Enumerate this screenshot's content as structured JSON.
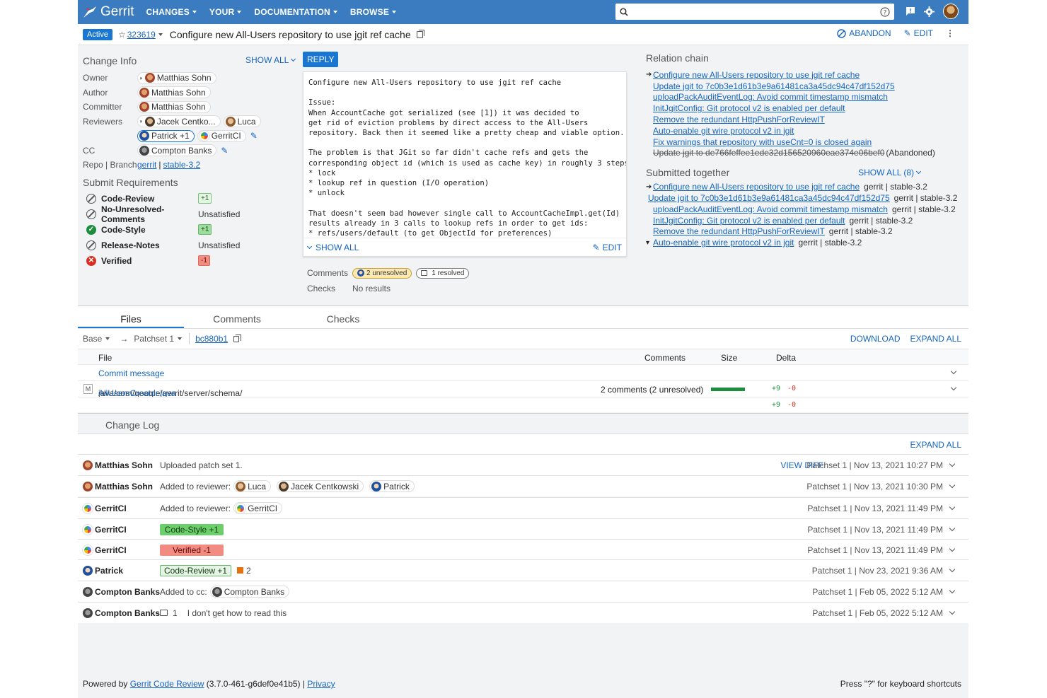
{
  "header": {
    "app_name": "Gerrit",
    "nav": [
      "CHANGES",
      "YOUR",
      "DOCUMENTATION",
      "BROWSE"
    ],
    "search_placeholder": "",
    "colors": {
      "brand": "#3b7bbf",
      "accent": "#1976d2"
    }
  },
  "change": {
    "status": "Active",
    "number": "323619",
    "subject": "Configure new All-Users repository to use jgit ref cache",
    "actions": {
      "abandon": "ABANDON",
      "edit": "EDIT"
    }
  },
  "change_info": {
    "title": "Change Info",
    "show_all": "SHOW ALL",
    "labels": {
      "owner": "Owner",
      "author": "Author",
      "committer": "Committer",
      "reviewers": "Reviewers",
      "cc": "CC",
      "repo_branch": "Repo | Branch"
    },
    "owner": "Matthias Sohn",
    "author": "Matthias Sohn",
    "committer": "Matthias Sohn",
    "reviewers": [
      "Jacek Centko...",
      "Luca",
      "Patrick +1",
      "GerritCI"
    ],
    "cc": [
      "Compton Banks"
    ],
    "repo": "gerrit",
    "branch": "stable-3.2"
  },
  "submit_requirements": {
    "title": "Submit Requirements",
    "items": [
      {
        "name": "Code-Review",
        "status": "neutral",
        "value": "+1"
      },
      {
        "name": "No-Unresolved-Comments",
        "status": "neutral",
        "value": "Unsatisfied"
      },
      {
        "name": "Code-Style",
        "status": "ok",
        "value": "+1"
      },
      {
        "name": "Release-Notes",
        "status": "neutral",
        "value": "Unsatisfied"
      },
      {
        "name": "Verified",
        "status": "bad",
        "value": "-1"
      }
    ]
  },
  "message": {
    "reply": "REPLY",
    "body": "Configure new All-Users repository to use jgit ref cache\n\nIssue:\nWhen AccountCache got serialized (see [1]) it was decided to\nget rid of eviction problems by direct access to the All-Users\nrepository. Back then it seemed like a pretty cheap and viable option.\n\nThe problem is that JGit so far didn't cache refs and gets the\ncorresponding object id (which is used as cache key) in roughly 3 steps:\n* lock\n* lookup ref in question (I/O operation)\n* unlock\n\nThat doesn't seem bad however single call to AccountCacheImpl.get(Id)\nresults already in 3 calls to lookup refs in order to get ids:\n* refs/users/default (to get ObjectId for preferences)",
    "show_all": "SHOW ALL",
    "edit": "EDIT"
  },
  "meta": {
    "comments_label": "Comments",
    "unresolved": "2 unresolved",
    "resolved": "1 resolved",
    "checks_label": "Checks",
    "checks_value": "No results"
  },
  "relation_chain": {
    "title": "Relation chain",
    "items": [
      {
        "text": "Configure new All-Users repository to use jgit ref cache",
        "current": true
      },
      {
        "text": "Update jgit to 7c0b3e1d61b3e9a61481ca3a45dc94c47df152d75"
      },
      {
        "text": "uploadPackAuditEventLog: Avoid commit timestamp mismatch"
      },
      {
        "text": "InitJgitConfig: Git protocol v2 is enabled per default"
      },
      {
        "text": "Remove the redundant HttpPushForReviewIT"
      },
      {
        "text": "Auto-enable git wire protocol v2 in jgit"
      },
      {
        "text": "Fix warnings that repository with useCnt=0 is closed again"
      },
      {
        "text": "Update jgit to de766feffee1ede32d156520960eae374e06bef0",
        "abandoned": true,
        "suffix": "(Abandoned)"
      }
    ]
  },
  "submitted_together": {
    "title": "Submitted together",
    "show_all": "SHOW ALL (8)",
    "items": [
      {
        "text": "Configure new All-Users repository to use jgit ref cache",
        "meta": "gerrit | stable-3.2",
        "marker": "arrow"
      },
      {
        "text": "Update jgit to 7c0b3e1d61b3e9a61481ca3a45dc94c47df152d75",
        "meta": "gerrit | stable-3.2"
      },
      {
        "text": "uploadPackAuditEventLog: Avoid commit timestamp mismatch",
        "meta": "gerrit | stable-3.2"
      },
      {
        "text": "InitJgitConfig: Git protocol v2 is enabled per default",
        "meta": "gerrit | stable-3.2"
      },
      {
        "text": "Remove the redundant HttpPushForReviewIT",
        "meta": "gerrit | stable-3.2"
      },
      {
        "text": "Auto-enable git wire protocol v2 in jgit",
        "meta": "gerrit | stable-3.2",
        "marker": "caret"
      }
    ]
  },
  "tabs": [
    "Files",
    "Comments",
    "Checks"
  ],
  "files": {
    "base": "Base",
    "arrow": "→",
    "patchset": "Patchset 1",
    "commit": "bc880b1",
    "download": "DOWNLOAD",
    "expand_all": "EXPAND ALL",
    "columns": {
      "file": "File",
      "comments": "Comments",
      "size": "Size",
      "delta": "Delta"
    },
    "commit_message": "Commit message",
    "rows": [
      {
        "status": "M",
        "path_prefix": "java/com/google/gerrit/server/schema/",
        "path_file": "AllUsersCreator.java",
        "comments": "2 comments (2 unresolved)",
        "size_fraction": 1.0,
        "added": "+9",
        "removed": "-0"
      }
    ],
    "total": {
      "added": "+9",
      "removed": "-0"
    }
  },
  "change_log": {
    "title": "Change Log",
    "expand_all": "EXPAND ALL",
    "view_diff": "VIEW DIFF",
    "added_to_reviewer": "Added to reviewer:",
    "added_to_cc": "Added to cc:",
    "entries": [
      {
        "author": "Matthias Sohn",
        "message": "Uploaded patch set 1.",
        "date": "Patchset 1 | Nov 13, 2021 10:27 PM"
      },
      {
        "author": "Matthias Sohn",
        "reviewers": [
          "Luca",
          "Jacek Centkowski",
          "Patrick"
        ],
        "date": "Patchset 1 | Nov 13, 2021 10:30 PM"
      },
      {
        "author": "GerritCI",
        "reviewers": [
          "GerritCI"
        ],
        "date": "Patchset 1 | Nov 13, 2021 11:49 PM"
      },
      {
        "author": "GerritCI",
        "label": "Code-Style +1",
        "date": "Patchset 1 | Nov 13, 2021 11:49 PM"
      },
      {
        "author": "GerritCI",
        "label": "Verified -1",
        "date": "Patchset 1 | Nov 13, 2021 11:49 PM"
      },
      {
        "author": "Patrick",
        "label": "Code-Review +1",
        "count": "2",
        "date": "Patchset 1 | Nov 23, 2021 9:36 AM"
      },
      {
        "author": "Compton Banks",
        "cc": [
          "Compton Banks"
        ],
        "date": "Patchset 1 | Feb 05, 2022 5:12 AM"
      },
      {
        "author": "Compton Banks",
        "count": "1",
        "message": "I don't get how to read this",
        "date": "Patchset 1 | Feb 05, 2022 5:12 AM"
      }
    ]
  },
  "footer": {
    "powered_by": "Powered by",
    "link": "Gerrit Code Review",
    "version": "(3.7.0-461-g6def0e41b5) |",
    "privacy": "Privacy",
    "shortcuts": "Press \"?\" for keyboard shortcuts"
  }
}
